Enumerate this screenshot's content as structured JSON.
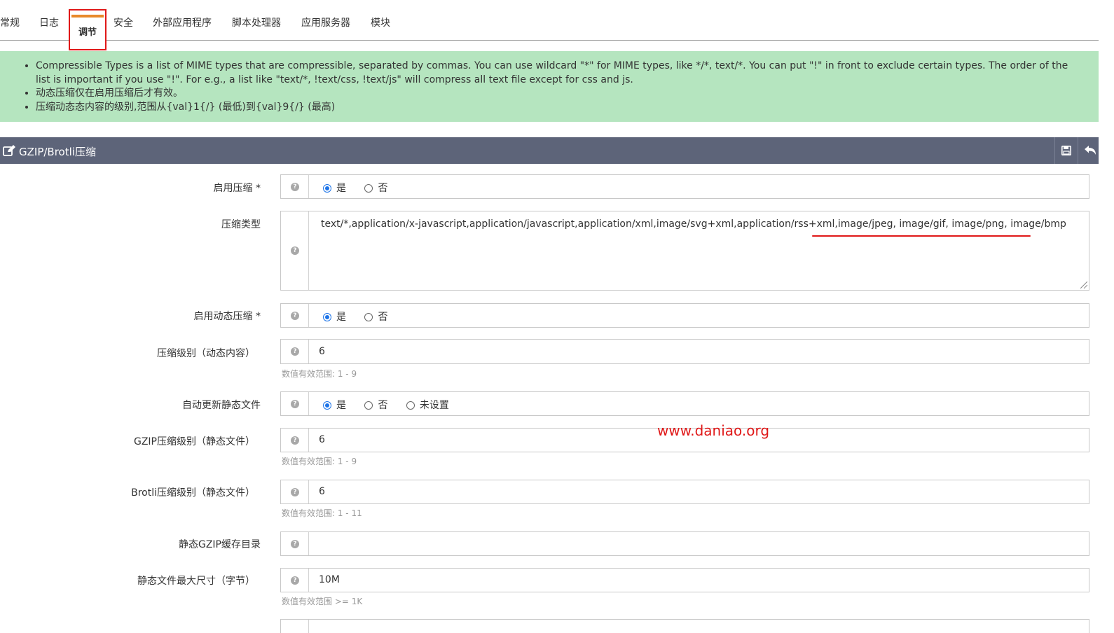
{
  "tabs": [
    {
      "label": "常规"
    },
    {
      "label": "日志"
    },
    {
      "label": "调节"
    },
    {
      "label": "安全"
    },
    {
      "label": "外部应用程序"
    },
    {
      "label": "脚本处理器"
    },
    {
      "label": "应用服务器"
    },
    {
      "label": "模块"
    }
  ],
  "active_tab": "调节",
  "info": {
    "items": [
      "Compressible Types is a list of MIME types that are compressible, separated by commas. You can use wildcard \"*\" for MIME types, like */*, text/*. You can put \"!\" in front to exclude certain types. The order of the list is important if you use \"!\". For e.g., a list like \"text/*, !text/css, !text/js\" will compress all text file except for css and js.",
      "动态压缩仅在启用压缩后才有效。",
      "压缩动态态内容的级别,范围从{val}1{/} (最低)到{val}9{/} (最高)"
    ]
  },
  "panel": {
    "title": "GZIP/Brotli压缩",
    "icons": {
      "title_icon": "edit-icon",
      "save": "save-icon",
      "back": "undo-icon"
    }
  },
  "form": {
    "enable_compression": {
      "label": "启用压缩 *",
      "options": [
        "是",
        "否"
      ],
      "selected": "是"
    },
    "compress_types": {
      "label": "压缩类型",
      "value_a": "text/*,application/x-javascript,application/javascript,application/xml,image/svg+xml,application/rss+xml,",
      "value_b": "image/jpeg, image/gif, image/png, image/bmp"
    },
    "enable_dynamic": {
      "label": "启用动态压缩 *",
      "options": [
        "是",
        "否"
      ],
      "selected": "是"
    },
    "dynamic_level": {
      "label": "压缩级别（动态内容）",
      "value": "6",
      "hint": "数值有效范围: 1 - 9"
    },
    "auto_update_static": {
      "label": "自动更新静态文件",
      "options": [
        "是",
        "否",
        "未设置"
      ],
      "selected": "是"
    },
    "gzip_static_level": {
      "label": "GZIP压缩级别（静态文件）",
      "value": "6",
      "hint": "数值有效范围: 1 - 9"
    },
    "brotli_static_level": {
      "label": "Brotli压缩级别（静态文件）",
      "value": "6",
      "hint": "数值有效范围: 1 - 11"
    },
    "static_gzip_cache_dir": {
      "label": "静态GZIP缓存目录",
      "value": ""
    },
    "static_max_size": {
      "label": "静态文件最大尺寸（字节）",
      "value": "10M",
      "hint": "数值有效范围 >= 1K"
    }
  },
  "watermark": "www.daniao.org",
  "colors": {
    "accent_red": "#e01818",
    "tab_orange": "#e8892a",
    "info_green": "#b5e5bf",
    "header": "#5d6479",
    "radio_blue": "#1d74e8"
  }
}
